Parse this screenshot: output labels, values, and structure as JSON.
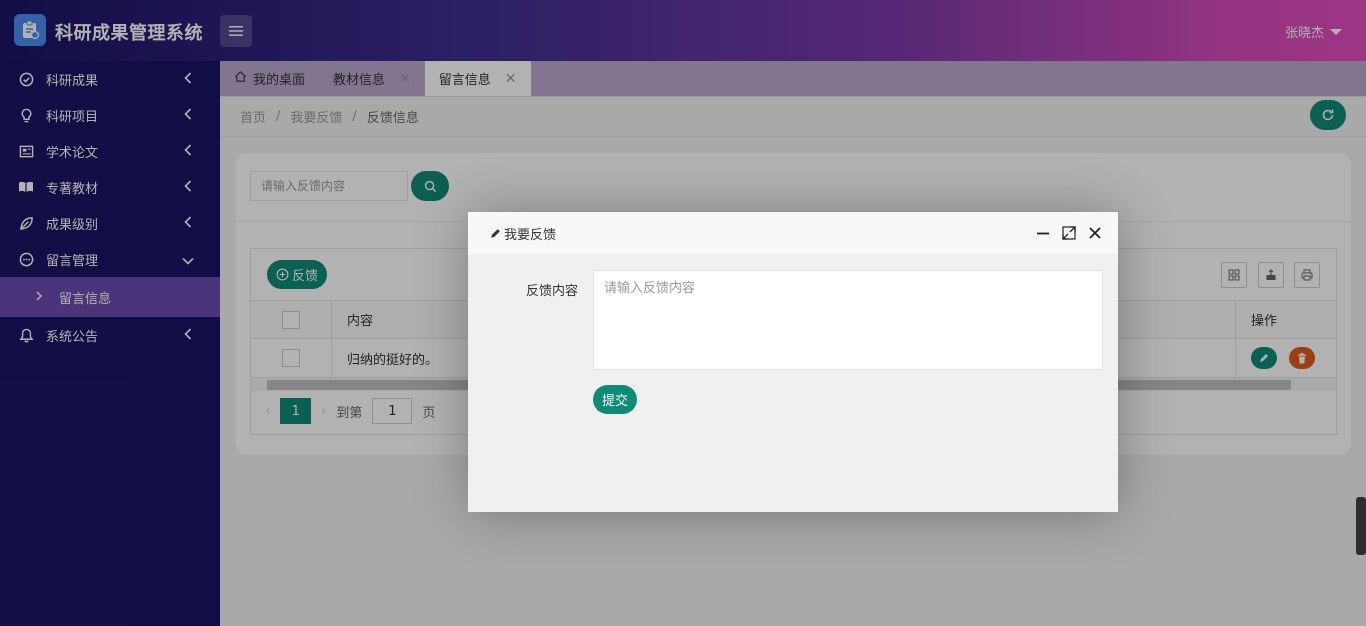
{
  "app": {
    "title": "科研成果管理系统",
    "user": "张晓杰"
  },
  "sidebar": {
    "items": [
      {
        "label": "科研成果",
        "icon": "check-circle-icon"
      },
      {
        "label": "科研项目",
        "icon": "lightbulb-icon"
      },
      {
        "label": "学术论文",
        "icon": "newspaper-icon"
      },
      {
        "label": "专著教材",
        "icon": "book-open-icon"
      },
      {
        "label": "成果级别",
        "icon": "leaf-icon"
      },
      {
        "label": "留言管理",
        "icon": "message-circle-icon"
      }
    ],
    "sub_item": {
      "label": "留言信息"
    },
    "last_item": {
      "label": "系统公告",
      "icon": "bell-icon"
    }
  },
  "tabs": [
    {
      "label": "我的桌面"
    },
    {
      "label": "教材信息"
    },
    {
      "label": "留言信息"
    }
  ],
  "breadcrumb": {
    "home": "首页",
    "sep": "/",
    "parent": "我要反馈",
    "current": "反馈信息"
  },
  "search": {
    "placeholder": "请输入反馈内容"
  },
  "table": {
    "add_label": "反馈",
    "headers": {
      "content": "内容",
      "ops": "操作"
    },
    "rows": [
      {
        "content": "归纳的挺好的。"
      }
    ]
  },
  "pager": {
    "current": "1",
    "goto": "到第",
    "page_value": "1",
    "page_unit": "页"
  },
  "modal": {
    "title": "我要反馈",
    "field_label": "反馈内容",
    "placeholder": "请输入反馈内容",
    "submit": "提交"
  },
  "colors": {
    "primary": "#0d8a78",
    "danger": "#e05a1c",
    "sidebar": "#1c1464",
    "active_sub": "#6a4db0"
  }
}
